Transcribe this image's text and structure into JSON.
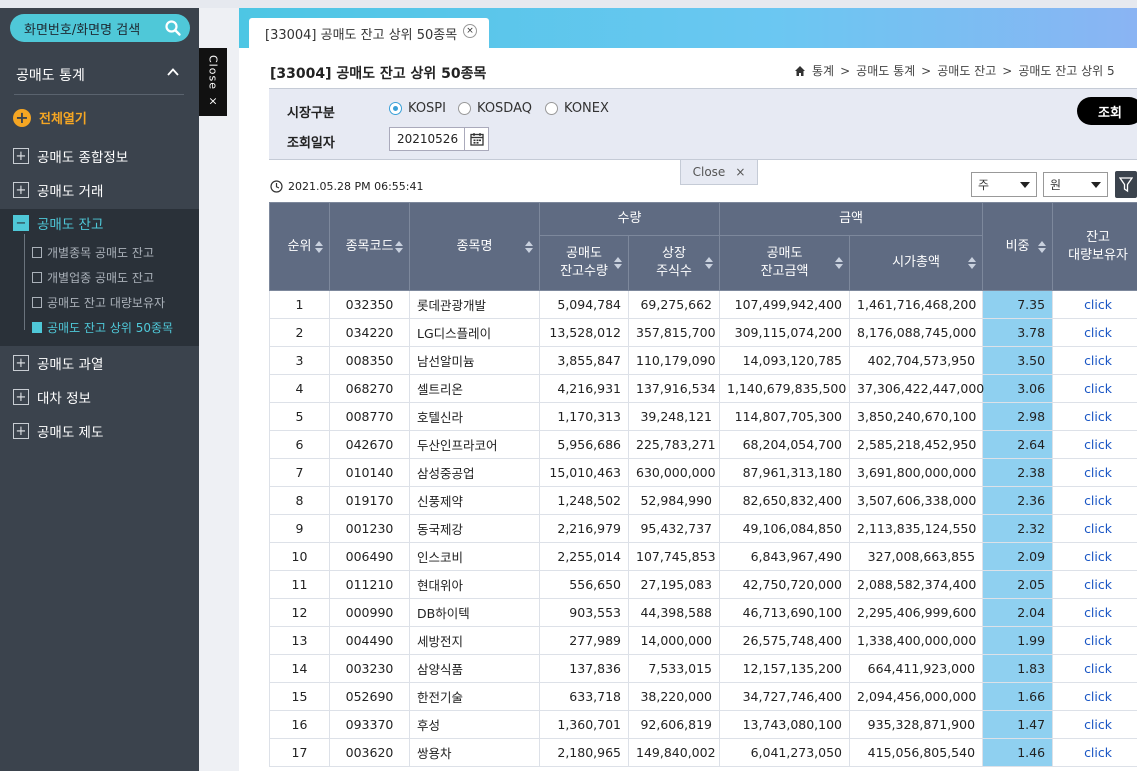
{
  "sidebar": {
    "search_label": "화면번호/화면명 검색",
    "section_title": "공매도 통계",
    "expand_all": "전체열기",
    "menus": [
      {
        "label": "공매도 종합정보",
        "state": "closed"
      },
      {
        "label": "공매도 거래",
        "state": "closed"
      },
      {
        "label": "공매도 잔고",
        "state": "open"
      },
      {
        "label": "공매도 과열",
        "state": "closed"
      },
      {
        "label": "대차 정보",
        "state": "closed"
      },
      {
        "label": "공매도 제도",
        "state": "closed"
      }
    ],
    "submenus": [
      {
        "label": "개별종목 공매도 잔고"
      },
      {
        "label": "개별업종 공매도 잔고"
      },
      {
        "label": "공매도 잔고 대량보유자"
      },
      {
        "label": "공매도 잔고 상위 50종목"
      }
    ],
    "close_tab": "Close ×"
  },
  "tab": {
    "label": "[33004] 공매도 잔고 상위 50종목",
    "close": "×"
  },
  "page": {
    "title": "[33004] 공매도 잔고 상위 50종목",
    "breadcrumb": [
      "통계",
      "공매도 통계",
      "공매도 잔고",
      "공매도 잔고 상위 5"
    ]
  },
  "filter": {
    "market_label": "시장구분",
    "markets": [
      "KOSPI",
      "KOSDAQ",
      "KONEX"
    ],
    "selected_market": "KOSPI",
    "date_label": "조회일자",
    "date_value": "20210526",
    "query_button": "조회",
    "close_bar": "Close",
    "close_x": "×"
  },
  "toolbar": {
    "timestamp": "2021.05.28 PM 06:55:41",
    "period_select": "주",
    "unit_select": "원"
  },
  "table": {
    "headers": {
      "rank": "순위",
      "code": "종목코드",
      "name": "종목명",
      "qty_group": "수량",
      "amount_group": "금액",
      "short_qty": "공매도\n잔고수량",
      "listed_shares": "상장\n주식수",
      "short_amount": "공매도\n잔고금액",
      "market_cap": "시가총액",
      "ratio": "비중",
      "holder": "잔고\n대량보유자"
    },
    "rows": [
      {
        "rank": "1",
        "code": "032350",
        "name": "롯데관광개발",
        "qty": "5,094,784",
        "shares": "69,275,662",
        "amt": "107,499,942,400",
        "cap": "1,461,716,468,200",
        "ratio": "7.35",
        "link": "click"
      },
      {
        "rank": "2",
        "code": "034220",
        "name": "LG디스플레이",
        "qty": "13,528,012",
        "shares": "357,815,700",
        "amt": "309,115,074,200",
        "cap": "8,176,088,745,000",
        "ratio": "3.78",
        "link": "click"
      },
      {
        "rank": "3",
        "code": "008350",
        "name": "남선알미늄",
        "qty": "3,855,847",
        "shares": "110,179,090",
        "amt": "14,093,120,785",
        "cap": "402,704,573,950",
        "ratio": "3.50",
        "link": "click"
      },
      {
        "rank": "4",
        "code": "068270",
        "name": "셀트리온",
        "qty": "4,216,931",
        "shares": "137,916,534",
        "amt": "1,140,679,835,500",
        "cap": "37,306,422,447,000",
        "ratio": "3.06",
        "link": "click"
      },
      {
        "rank": "5",
        "code": "008770",
        "name": "호텔신라",
        "qty": "1,170,313",
        "shares": "39,248,121",
        "amt": "114,807,705,300",
        "cap": "3,850,240,670,100",
        "ratio": "2.98",
        "link": "click"
      },
      {
        "rank": "6",
        "code": "042670",
        "name": "두산인프라코어",
        "qty": "5,956,686",
        "shares": "225,783,271",
        "amt": "68,204,054,700",
        "cap": "2,585,218,452,950",
        "ratio": "2.64",
        "link": "click"
      },
      {
        "rank": "7",
        "code": "010140",
        "name": "삼성중공업",
        "qty": "15,010,463",
        "shares": "630,000,000",
        "amt": "87,961,313,180",
        "cap": "3,691,800,000,000",
        "ratio": "2.38",
        "link": "click"
      },
      {
        "rank": "8",
        "code": "019170",
        "name": "신풍제약",
        "qty": "1,248,502",
        "shares": "52,984,990",
        "amt": "82,650,832,400",
        "cap": "3,507,606,338,000",
        "ratio": "2.36",
        "link": "click"
      },
      {
        "rank": "9",
        "code": "001230",
        "name": "동국제강",
        "qty": "2,216,979",
        "shares": "95,432,737",
        "amt": "49,106,084,850",
        "cap": "2,113,835,124,550",
        "ratio": "2.32",
        "link": "click"
      },
      {
        "rank": "10",
        "code": "006490",
        "name": "인스코비",
        "qty": "2,255,014",
        "shares": "107,745,853",
        "amt": "6,843,967,490",
        "cap": "327,008,663,855",
        "ratio": "2.09",
        "link": "click"
      },
      {
        "rank": "11",
        "code": "011210",
        "name": "현대위아",
        "qty": "556,650",
        "shares": "27,195,083",
        "amt": "42,750,720,000",
        "cap": "2,088,582,374,400",
        "ratio": "2.05",
        "link": "click"
      },
      {
        "rank": "12",
        "code": "000990",
        "name": "DB하이텍",
        "qty": "903,553",
        "shares": "44,398,588",
        "amt": "46,713,690,100",
        "cap": "2,295,406,999,600",
        "ratio": "2.04",
        "link": "click"
      },
      {
        "rank": "13",
        "code": "004490",
        "name": "세방전지",
        "qty": "277,989",
        "shares": "14,000,000",
        "amt": "26,575,748,400",
        "cap": "1,338,400,000,000",
        "ratio": "1.99",
        "link": "click"
      },
      {
        "rank": "14",
        "code": "003230",
        "name": "삼양식품",
        "qty": "137,836",
        "shares": "7,533,015",
        "amt": "12,157,135,200",
        "cap": "664,411,923,000",
        "ratio": "1.83",
        "link": "click"
      },
      {
        "rank": "15",
        "code": "052690",
        "name": "한전기술",
        "qty": "633,718",
        "shares": "38,220,000",
        "amt": "34,727,746,400",
        "cap": "2,094,456,000,000",
        "ratio": "1.66",
        "link": "click"
      },
      {
        "rank": "16",
        "code": "093370",
        "name": "후성",
        "qty": "1,360,701",
        "shares": "92,606,819",
        "amt": "13,743,080,100",
        "cap": "935,328,871,900",
        "ratio": "1.47",
        "link": "click"
      },
      {
        "rank": "17",
        "code": "003620",
        "name": "쌍용차",
        "qty": "2,180,965",
        "shares": "149,840,002",
        "amt": "6,041,273,050",
        "cap": "415,056,805,540",
        "ratio": "1.46",
        "link": "click"
      }
    ]
  },
  "colors": {
    "sidebar_bg": "#3b434d",
    "accent": "#4fc8d8",
    "orange": "#f5a623",
    "header_bg": "#5f6b82",
    "ratio_bg": "#8fd0f0"
  }
}
